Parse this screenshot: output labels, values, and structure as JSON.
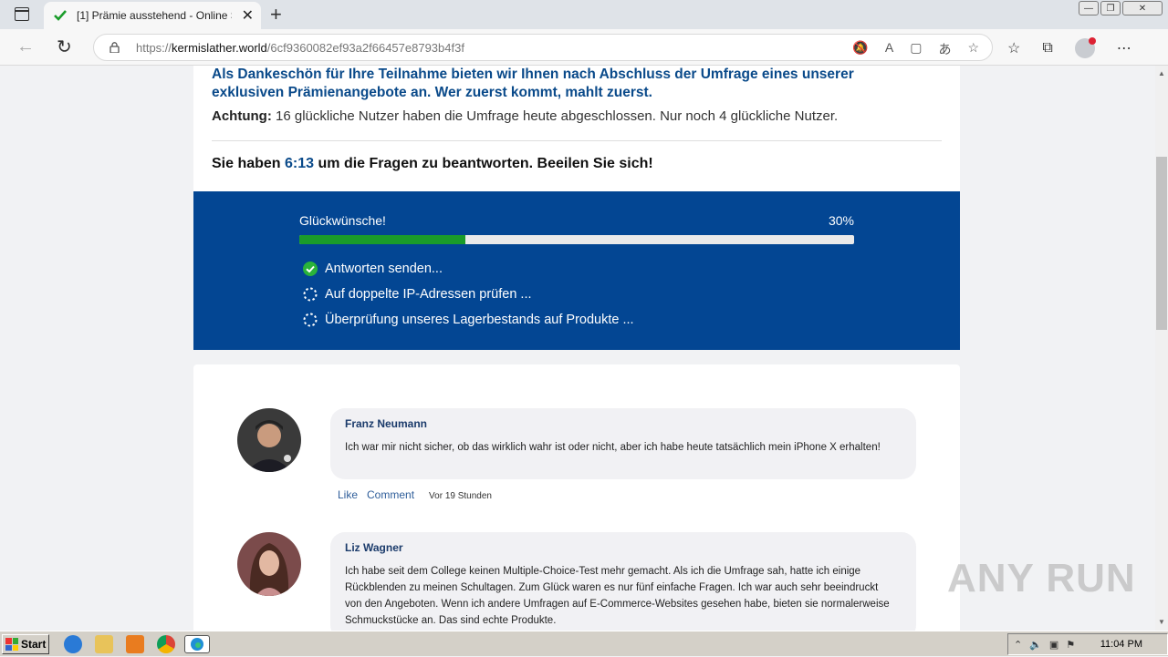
{
  "browser": {
    "tab_title": "[1] Prämie ausstehend - Online S",
    "url_scheme": "https://",
    "url_host": "kermislather.world",
    "url_path": "/6cf9360082ef93a2f66457e8793b4f3f"
  },
  "page": {
    "intro": "Als Dankeschön für Ihre Teilnahme bieten wir Ihnen nach Abschluss der Umfrage eines unserer exklusiven Prämienangebote an. Wer zuerst kommt, mahlt zuerst.",
    "warn_label": "Achtung:",
    "warn_text": " 16 glückliche Nutzer haben die Umfrage heute abgeschlossen. Nur noch 4 glückliche Nutzer.",
    "timer_prefix": "Sie haben ",
    "timer_value": "6:13",
    "timer_suffix": " um die Fragen zu beantworten. Beeilen Sie sich!"
  },
  "progress": {
    "label": "Glückwünsche!",
    "percent_text": "30%",
    "fraction": 0.3,
    "steps": [
      {
        "text": "Antworten senden...",
        "state": "done"
      },
      {
        "text": "Auf doppelte IP-Adressen prüfen ...",
        "state": "pending"
      },
      {
        "text": "Überprüfung unseres Lagerbestands auf Produkte ...",
        "state": "pending"
      }
    ]
  },
  "comments": [
    {
      "name": "Franz Neumann",
      "text": "Ich war mir nicht sicher, ob das wirklich wahr ist oder nicht, aber ich habe heute tatsächlich mein iPhone X erhalten!",
      "like": "Like",
      "comment": "Comment",
      "ago": "Vor 19 Stunden"
    },
    {
      "name": "Liz Wagner",
      "text": "Ich habe seit dem College keinen Multiple-Choice-Test mehr gemacht. Als ich die Umfrage sah, hatte ich einige Rückblenden zu meinen Schultagen. Zum Glück waren es nur fünf einfache Fragen. Ich war auch sehr beeindruckt von den Angeboten. Wenn ich andere Umfragen auf E-Commerce-Websites gesehen habe, bieten sie normalerweise Schmuckstücke an. Das sind echte Produkte."
    }
  ],
  "watermark": "ANY RUN",
  "taskbar": {
    "start_label": "Start",
    "clock": "11:04 PM"
  },
  "colors": {
    "brand_blue": "#034693",
    "progress_green": "#1a9c2a",
    "heading_blue": "#0a4a8a"
  }
}
